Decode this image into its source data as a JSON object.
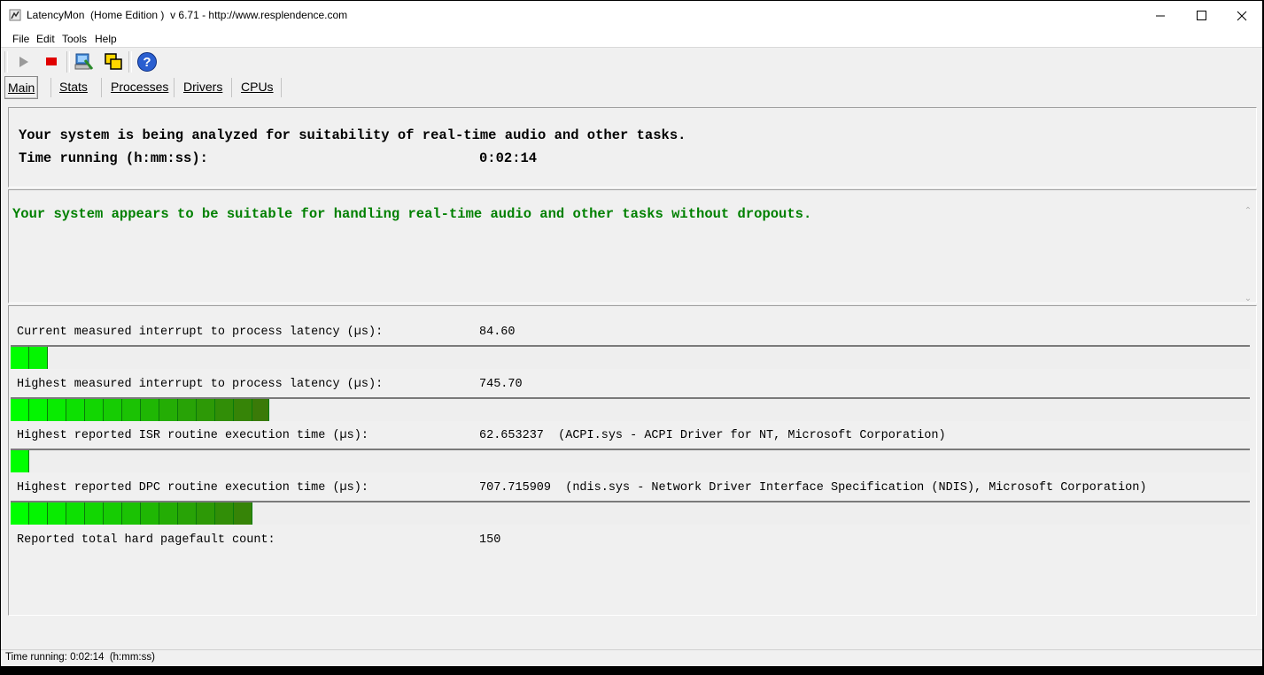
{
  "window": {
    "title": "LatencyMon  (Home Edition )  v 6.71 - http://www.resplendence.com",
    "minimize_label": "minimize",
    "maximize_label": "maximize",
    "close_label": "close"
  },
  "menu": {
    "items": [
      {
        "label": "File"
      },
      {
        "label": "Edit"
      },
      {
        "label": "Tools"
      },
      {
        "label": "Help"
      }
    ]
  },
  "toolbar": {
    "icons": [
      "play-icon",
      "stop-icon",
      "system-info-icon",
      "windows-icon",
      "help-icon"
    ]
  },
  "tabs": [
    {
      "label": "Main",
      "active": true
    },
    {
      "label": "Stats"
    },
    {
      "label": "Processes"
    },
    {
      "label": "Drivers"
    },
    {
      "label": "CPUs"
    }
  ],
  "header": {
    "analyzing_text": "Your system is being analyzed for suitability of real-time audio and other tasks.",
    "time_label": "Time running (h:mm:ss):",
    "time_value": "0:02:14"
  },
  "verdict": {
    "text": "Your system appears to be suitable for handling real-time audio and other tasks without dropouts.",
    "color": "#008000"
  },
  "metrics": [
    {
      "label": "Current measured interrupt to process latency (µs):",
      "value": "84.60",
      "bar_segments": 2
    },
    {
      "label": "Highest measured interrupt to process latency (µs):",
      "value": "745.70",
      "bar_segments": 14
    },
    {
      "label": "Highest reported ISR routine execution time (µs):",
      "value": "62.653237  (ACPI.sys - ACPI Driver for NT, Microsoft Corporation)",
      "bar_segments": 1
    },
    {
      "label": "Highest reported DPC routine execution time (µs):",
      "value": "707.715909  (ndis.sys - Network Driver Interface Specification (NDIS), Microsoft Corporation)",
      "bar_segments": 13
    },
    {
      "label": "Reported total hard pagefault count:",
      "value": "150"
    }
  ],
  "colors": {
    "bar_bright": "#00ff00",
    "bar_dark": "#3a7a08"
  },
  "statusbar": {
    "text": "Time running: 0:02:14  (h:mm:ss)"
  }
}
